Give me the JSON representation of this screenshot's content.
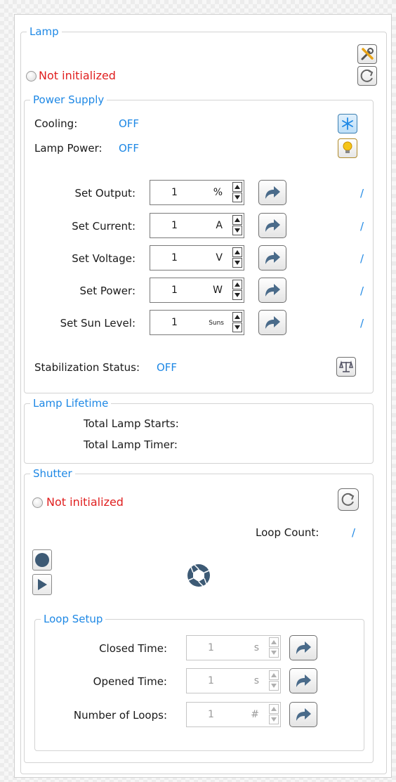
{
  "lamp": {
    "title": "Lamp",
    "status": "Not initialized",
    "power_supply": {
      "title": "Power Supply",
      "cooling_label": "Cooling:",
      "cooling_value": "OFF",
      "lamp_power_label": "Lamp Power:",
      "lamp_power_value": "OFF",
      "rows": [
        {
          "label": "Set Output:",
          "value": "1",
          "unit": "%",
          "readback": "/"
        },
        {
          "label": "Set Current:",
          "value": "1",
          "unit": "A",
          "readback": "/"
        },
        {
          "label": "Set Voltage:",
          "value": "1",
          "unit": "V",
          "readback": "/"
        },
        {
          "label": "Set Power:",
          "value": "1",
          "unit": "W",
          "readback": "/"
        },
        {
          "label": "Set Sun Level:",
          "value": "1",
          "unit": "Suns",
          "readback": "/"
        }
      ],
      "stabilization_label": "Stabilization Status:",
      "stabilization_value": "OFF"
    },
    "lifetime": {
      "title": "Lamp Lifetime",
      "starts_label": "Total Lamp Starts:",
      "timer_label": "Total Lamp Timer:"
    }
  },
  "shutter": {
    "title": "Shutter",
    "status": "Not initialized",
    "loop_count_label": "Loop Count:",
    "loop_count_value": "/",
    "loop_setup": {
      "title": "Loop Setup",
      "rows": [
        {
          "label": "Closed Time:",
          "value": "1",
          "unit": "s"
        },
        {
          "label": "Opened Time:",
          "value": "1",
          "unit": "s"
        },
        {
          "label": "Number of Loops:",
          "value": "1",
          "unit": "#"
        }
      ]
    }
  },
  "colors": {
    "accent": "#1e88e5",
    "error": "#e02020"
  },
  "icons": [
    "tools-icon",
    "refresh-icon",
    "snowflake-icon",
    "lightbulb-icon",
    "go-arrow-icon",
    "scale-icon",
    "record-icon",
    "play-icon",
    "shutter-aperture-icon"
  ]
}
